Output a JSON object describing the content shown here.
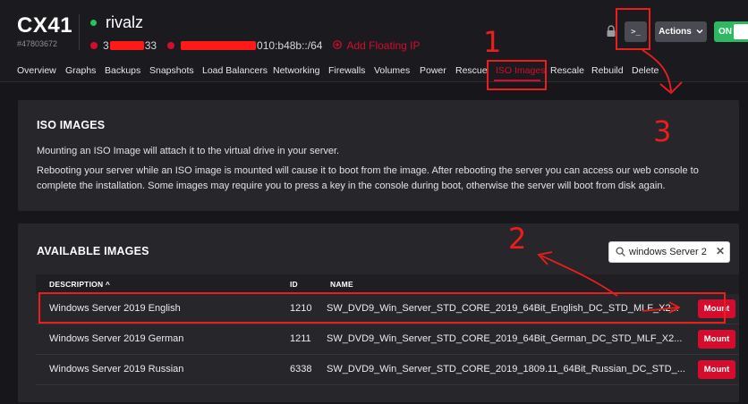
{
  "header": {
    "server_type": "CX41",
    "server_id": "#47803672",
    "server_name": "rivalz",
    "ipv4_visible": "3",
    "ipv4_suffix": "33",
    "ipv6_suffix": "010:b48b::/64",
    "floating_ip_label": "Add Floating IP",
    "console_label": ">_",
    "actions_label": "Actions",
    "power_toggle_label": "ON"
  },
  "tabs": [
    "Overview",
    "Graphs",
    "Backups",
    "Snapshots",
    "Load Balancers",
    "Networking",
    "Firewalls",
    "Volumes",
    "Power",
    "Rescue",
    "ISO Images",
    "Rescale",
    "Rebuild",
    "Delete"
  ],
  "iso_panel": {
    "title": "ISO IMAGES",
    "para1": "Mounting an ISO Image will attach it to the virtual drive in your server.",
    "para2": "Rebooting your server while an ISO image is mounted will cause it to boot from the image. After rebooting the server you can access our web console to complete the installation. Some images may require you to press a key in the console during boot, otherwise the server will boot from disk again."
  },
  "available": {
    "title": "AVAILABLE IMAGES",
    "search_value": "windows Server 2",
    "clear_glyph": "✕",
    "columns": {
      "description": "DESCRIPTION",
      "sort_glyph": "^",
      "id": "ID",
      "name": "NAME"
    },
    "mount_label": "Mount",
    "rows": [
      {
        "description": "Windows Server 2019 English",
        "id": "1210",
        "name": "SW_DVD9_Win_Server_STD_CORE_2019_64Bit_English_DC_STD_MLF_X2..."
      },
      {
        "description": "Windows Server 2019 German",
        "id": "1211",
        "name": "SW_DVD9_Win_Server_STD_CORE_2019_64Bit_German_DC_STD_MLF_X2..."
      },
      {
        "description": "Windows Server 2019 Russian",
        "id": "6338",
        "name": "SW_DVD9_Win_Server_STD_CORE_2019_1809.11_64Bit_Russian_DC_STD_..."
      }
    ]
  },
  "annotations": {
    "n1": "1",
    "n2": "2",
    "n3": "3"
  },
  "colors": {
    "accent_red": "#d50c2d",
    "status_green": "#23c45e",
    "annotation_red": "#ee1d1d",
    "background": "#17171b",
    "panel": "#26262b"
  }
}
